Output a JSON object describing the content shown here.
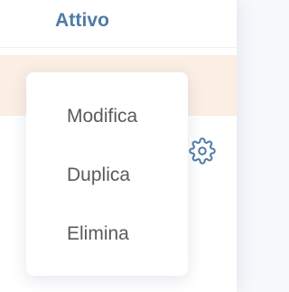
{
  "table": {
    "status_text": "Attivo",
    "rows": [
      {
        "settings_icon": "gear-icon"
      },
      {
        "settings_icon": "gear-icon"
      }
    ]
  },
  "dropdown_menu": {
    "items": [
      {
        "label": "Modifica"
      },
      {
        "label": "Duplica"
      },
      {
        "label": "Elimina"
      }
    ]
  },
  "colors": {
    "status_text": "#4f7aa7",
    "icon": "#4f7aa7",
    "highlight_row": "#fbeee3",
    "menu_text": "#5a5a5a"
  }
}
